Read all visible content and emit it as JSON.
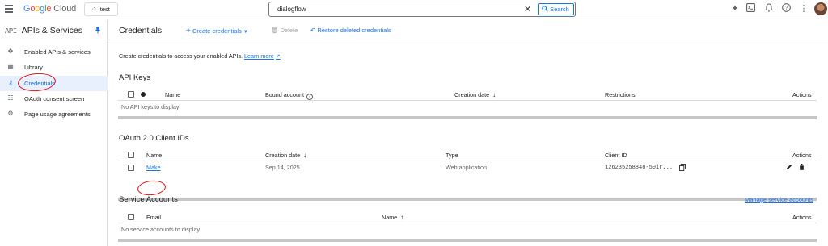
{
  "topbar": {
    "brand": {
      "g": "G",
      "o1": "o",
      "o2": "o",
      "g2": "g",
      "l": "l",
      "e": "e",
      "cloud": "Cloud"
    },
    "project": "test",
    "search_value": "dialogflow",
    "search_button": "Search"
  },
  "sidebar": {
    "api_mark": "API",
    "title": "APIs & Services",
    "items": [
      {
        "label": "Enabled APIs & services",
        "icon": "hub-icon"
      },
      {
        "label": "Library",
        "icon": "library-icon"
      },
      {
        "label": "Credentials",
        "icon": "key-icon"
      },
      {
        "label": "OAuth consent screen",
        "icon": "consent-icon"
      },
      {
        "label": "Page usage agreements",
        "icon": "settings-list-icon"
      }
    ]
  },
  "toolbar": {
    "title": "Credentials",
    "create": "Create credentials",
    "delete": "Delete",
    "restore": "Restore deleted credentials"
  },
  "intro": {
    "text": "Create credentials to access your enabled APIs.",
    "link": "Learn more"
  },
  "api_keys": {
    "title": "API Keys",
    "columns": {
      "name": "Name",
      "bound": "Bound account",
      "created": "Creation date",
      "restrictions": "Restrictions",
      "actions": "Actions"
    },
    "empty": "No API keys to display"
  },
  "oauth": {
    "title": "OAuth 2.0 Client IDs",
    "columns": {
      "name": "Name",
      "created": "Creation date",
      "type": "Type",
      "client_id": "Client ID",
      "actions": "Actions"
    },
    "rows": [
      {
        "name": "Make",
        "created": "Sep 14, 2025",
        "type": "Web application",
        "client_id": "126235258848-50ir..."
      }
    ]
  },
  "service_accounts": {
    "title": "Service Accounts",
    "manage": "Manage service accounts",
    "columns": {
      "email": "Email",
      "name": "Name",
      "actions": "Actions"
    },
    "empty": "No service accounts to display"
  },
  "colors": {
    "accent": "#1a73e8",
    "active_bg": "#e8f0fe",
    "annotation": "#e01313"
  }
}
